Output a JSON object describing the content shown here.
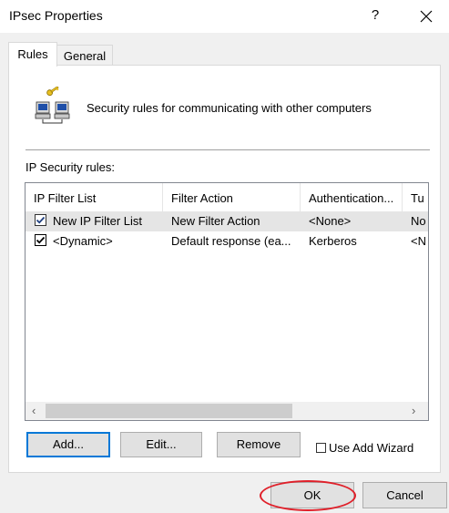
{
  "window": {
    "title": "IPsec Properties",
    "help_label": "?"
  },
  "tabs": [
    {
      "label": "Rules",
      "active": true
    },
    {
      "label": "General",
      "active": false
    }
  ],
  "header": {
    "description": "Security rules for communicating with other computers",
    "icon": "network-computers-icon"
  },
  "rules": {
    "label": "IP Security rules:",
    "columns": [
      "IP Filter List",
      "Filter Action",
      "Authentication...",
      "Tu"
    ],
    "rows": [
      {
        "checked": true,
        "selected": true,
        "filter_list": "New IP Filter List",
        "filter_action": "New Filter Action",
        "authentication": "<None>",
        "tunnel": "No"
      },
      {
        "checked": true,
        "selected": false,
        "filter_list": "<Dynamic>",
        "filter_action": "Default response (ea...",
        "authentication": "Kerberos",
        "tunnel": "<N"
      }
    ],
    "scroll_left": "‹",
    "scroll_right": "›"
  },
  "buttons": {
    "add": "Add...",
    "edit": "Edit...",
    "remove": "Remove",
    "ok": "OK",
    "cancel": "Cancel"
  },
  "wizard": {
    "label": "Use Add Wizard",
    "checked": false
  },
  "colors": {
    "accent": "#0078d7",
    "highlight": "#e0202a",
    "selection": "#e5e5e5"
  }
}
